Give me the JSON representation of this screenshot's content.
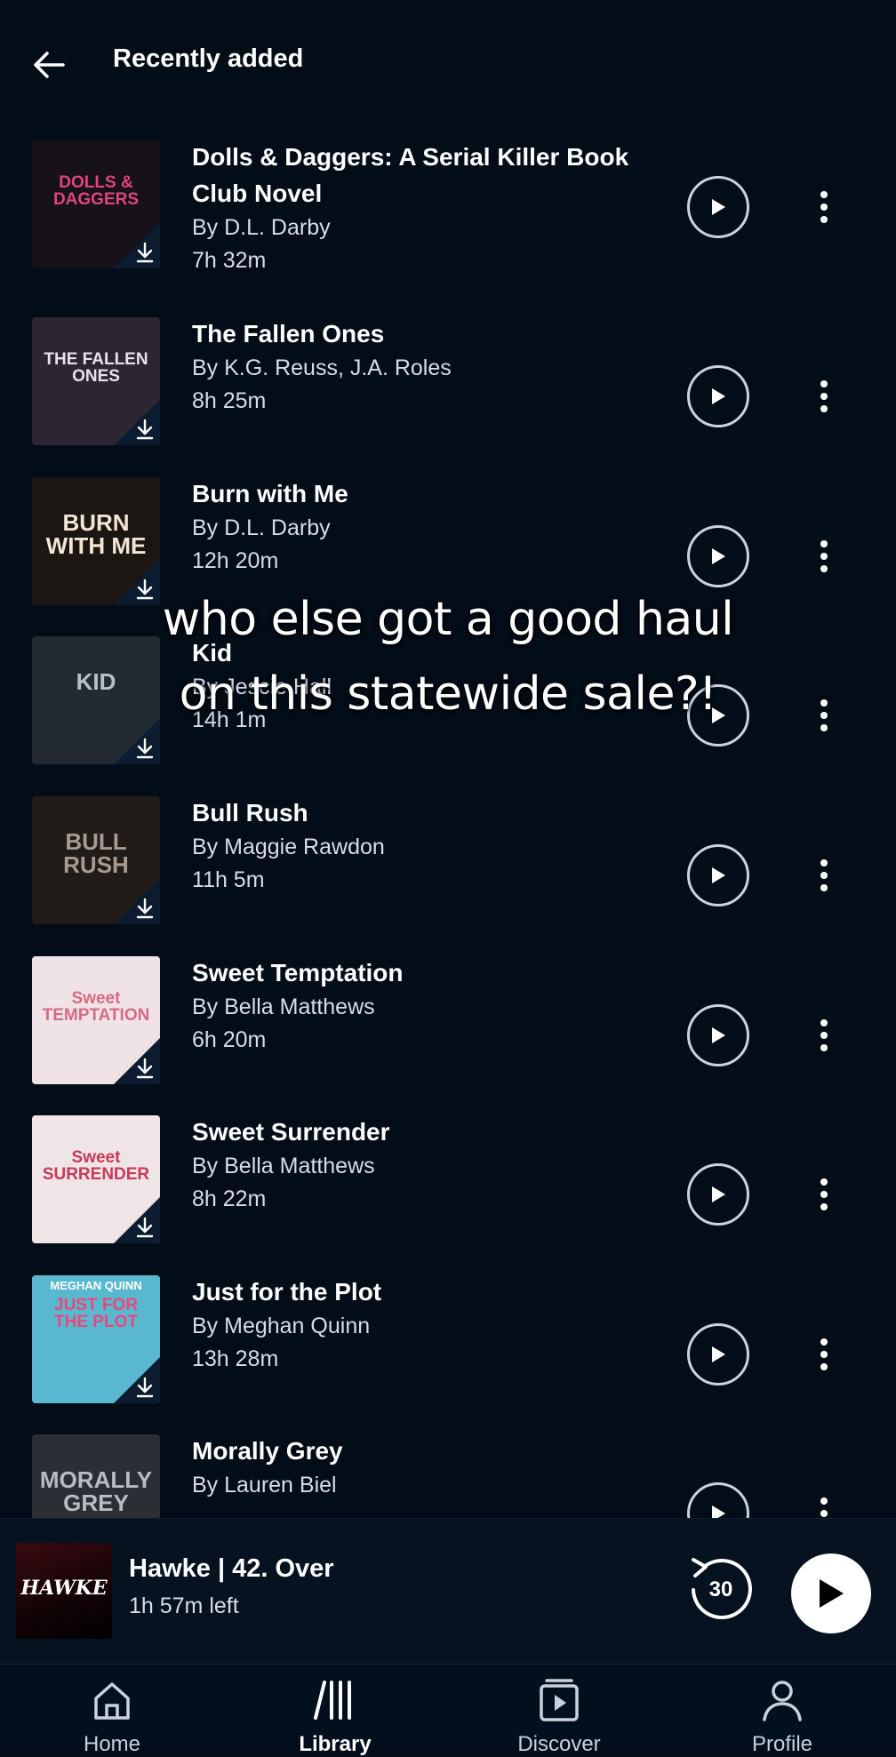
{
  "header": {
    "title": "Recently added",
    "back_icon": "arrow-left-icon"
  },
  "books": [
    {
      "title": "Dolls & Daggers: A Serial Killer Book Club Novel",
      "author": "By D.L. Darby",
      "duration": "7h 32m",
      "cover": {
        "text": "DOLLS & DAGGERS",
        "bg": "#17111a",
        "accent": "#e0457e"
      }
    },
    {
      "title": "The Fallen Ones",
      "author": "By K.G. Reuss, J.A. Roles",
      "duration": "8h 25m",
      "cover": {
        "text": "THE FALLEN ONES",
        "bg": "#2c2633",
        "accent": "#e8e0ea"
      }
    },
    {
      "title": "Burn with Me",
      "author": "By D.L. Darby",
      "duration": "12h 20m",
      "cover": {
        "text": "BURN WITH ME",
        "bg": "#1c1612",
        "accent": "#f2e6d2"
      }
    },
    {
      "title": "Kid",
      "author": "By Jescie Hall",
      "duration": "14h 1m",
      "cover": {
        "text": "KID",
        "bg": "#232a31",
        "accent": "#b8c0c8"
      }
    },
    {
      "title": "Bull Rush",
      "author": "By Maggie Rawdon",
      "duration": "11h 5m",
      "cover": {
        "text": "BULL RUSH",
        "bg": "#211b19",
        "accent": "#a89a8e"
      }
    },
    {
      "title": "Sweet Temptation",
      "author": "By Bella Matthews",
      "duration": "6h 20m",
      "cover": {
        "text": "Sweet TEMPTATION",
        "bg": "#efe3e6",
        "accent": "#d86a86"
      }
    },
    {
      "title": "Sweet Surrender",
      "author": "By Bella Matthews",
      "duration": "8h 22m",
      "cover": {
        "text": "Sweet SURRENDER",
        "bg": "#efe4e6",
        "accent": "#c73a5b"
      }
    },
    {
      "title": "Just for the Plot",
      "author": "By Meghan Quinn",
      "duration": "13h 28m",
      "cover": {
        "text": "JUST FOR THE PLOT",
        "bg": "#59b8cf",
        "accent": "#e8487c",
        "top_text": "MEGHAN QUINN"
      }
    },
    {
      "title": "Morally Grey",
      "author": "By Lauren Biel",
      "duration": "",
      "cover": {
        "text": "MORALLY GREY",
        "bg": "#2b2f35",
        "accent": "#b8bcc2"
      }
    }
  ],
  "overlay_caption": {
    "line1": "who else got a good haul",
    "line2": "on this statewide sale?!"
  },
  "mini_player": {
    "title": "Hawke | 42. Over",
    "subtitle": "1h 57m left",
    "cover_text": "HAWKE",
    "skip_seconds": "30"
  },
  "nav": [
    {
      "label": "Home",
      "icon": "home-icon"
    },
    {
      "label": "Library",
      "icon": "library-icon"
    },
    {
      "label": "Discover",
      "icon": "discover-icon"
    },
    {
      "label": "Profile",
      "icon": "profile-icon"
    }
  ],
  "colors": {
    "background": "#030d18",
    "mini_player_bg": "#06121f",
    "nav_bg": "#02101d",
    "text": "#ffffff",
    "muted_text": "#d6dde6"
  }
}
